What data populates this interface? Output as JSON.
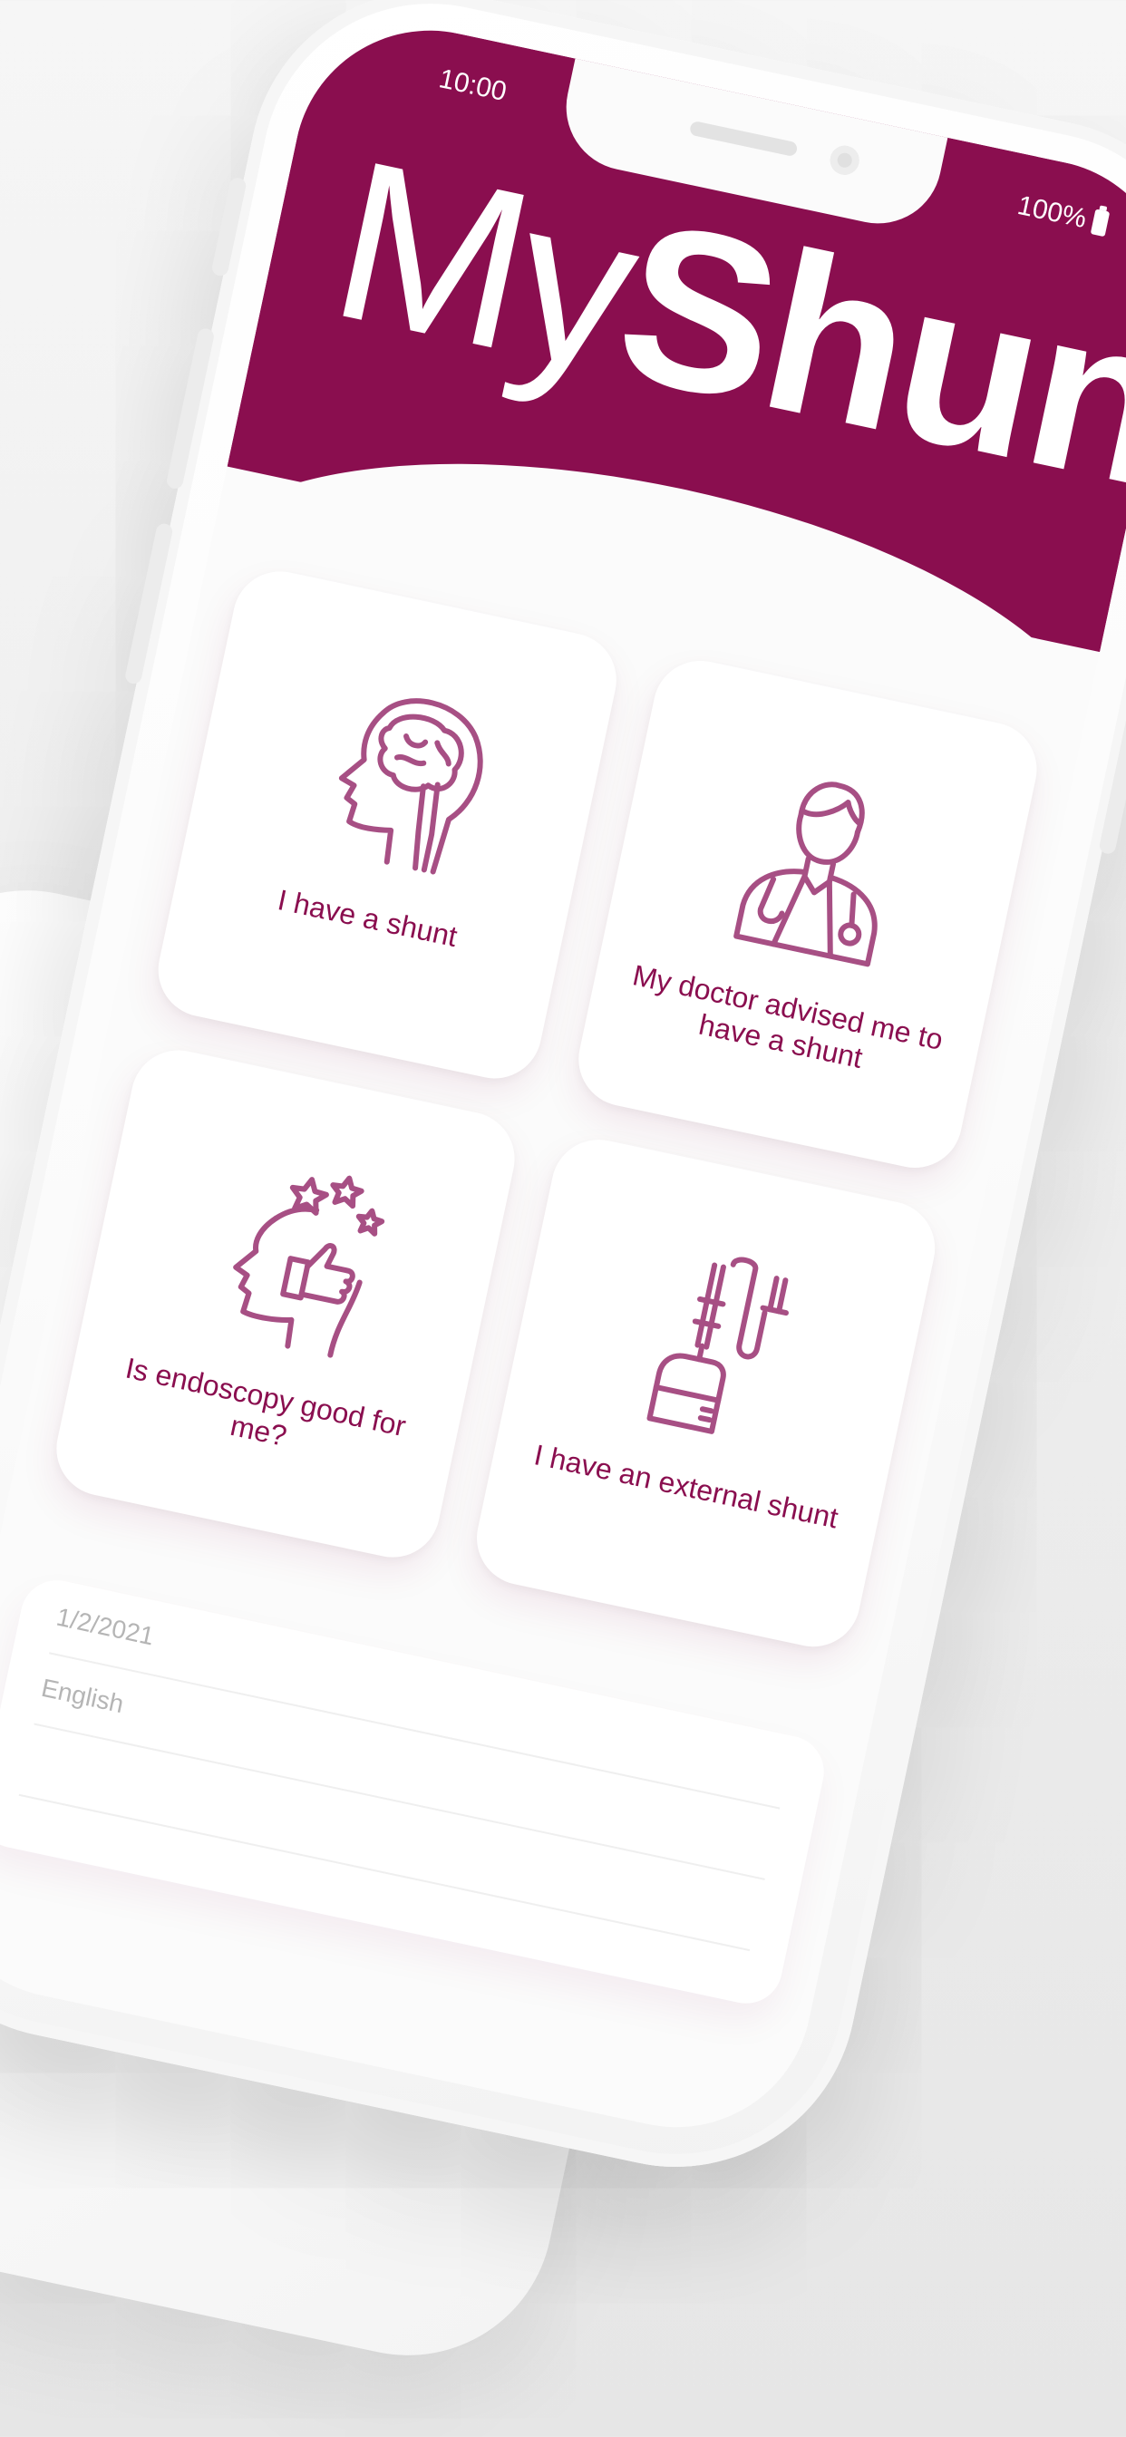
{
  "status_bar": {
    "time": "10:00",
    "battery": "100%"
  },
  "header": {
    "logo_my": "My",
    "logo_shunt": "Shunt"
  },
  "cards": [
    {
      "label": "I have a shunt",
      "icon": "brain-head-icon"
    },
    {
      "label": "My doctor advised me to have a shunt",
      "icon": "doctor-icon"
    },
    {
      "label": "Is endoscopy good for me?",
      "icon": "head-thumbs-up-icon"
    },
    {
      "label": "I have an external shunt",
      "icon": "drainage-bag-icon"
    }
  ],
  "list": {
    "rows": [
      "1/2/2021",
      "English",
      "",
      ""
    ]
  },
  "colors": {
    "brand": "#8a0e4f",
    "icon": "#a74f84"
  }
}
